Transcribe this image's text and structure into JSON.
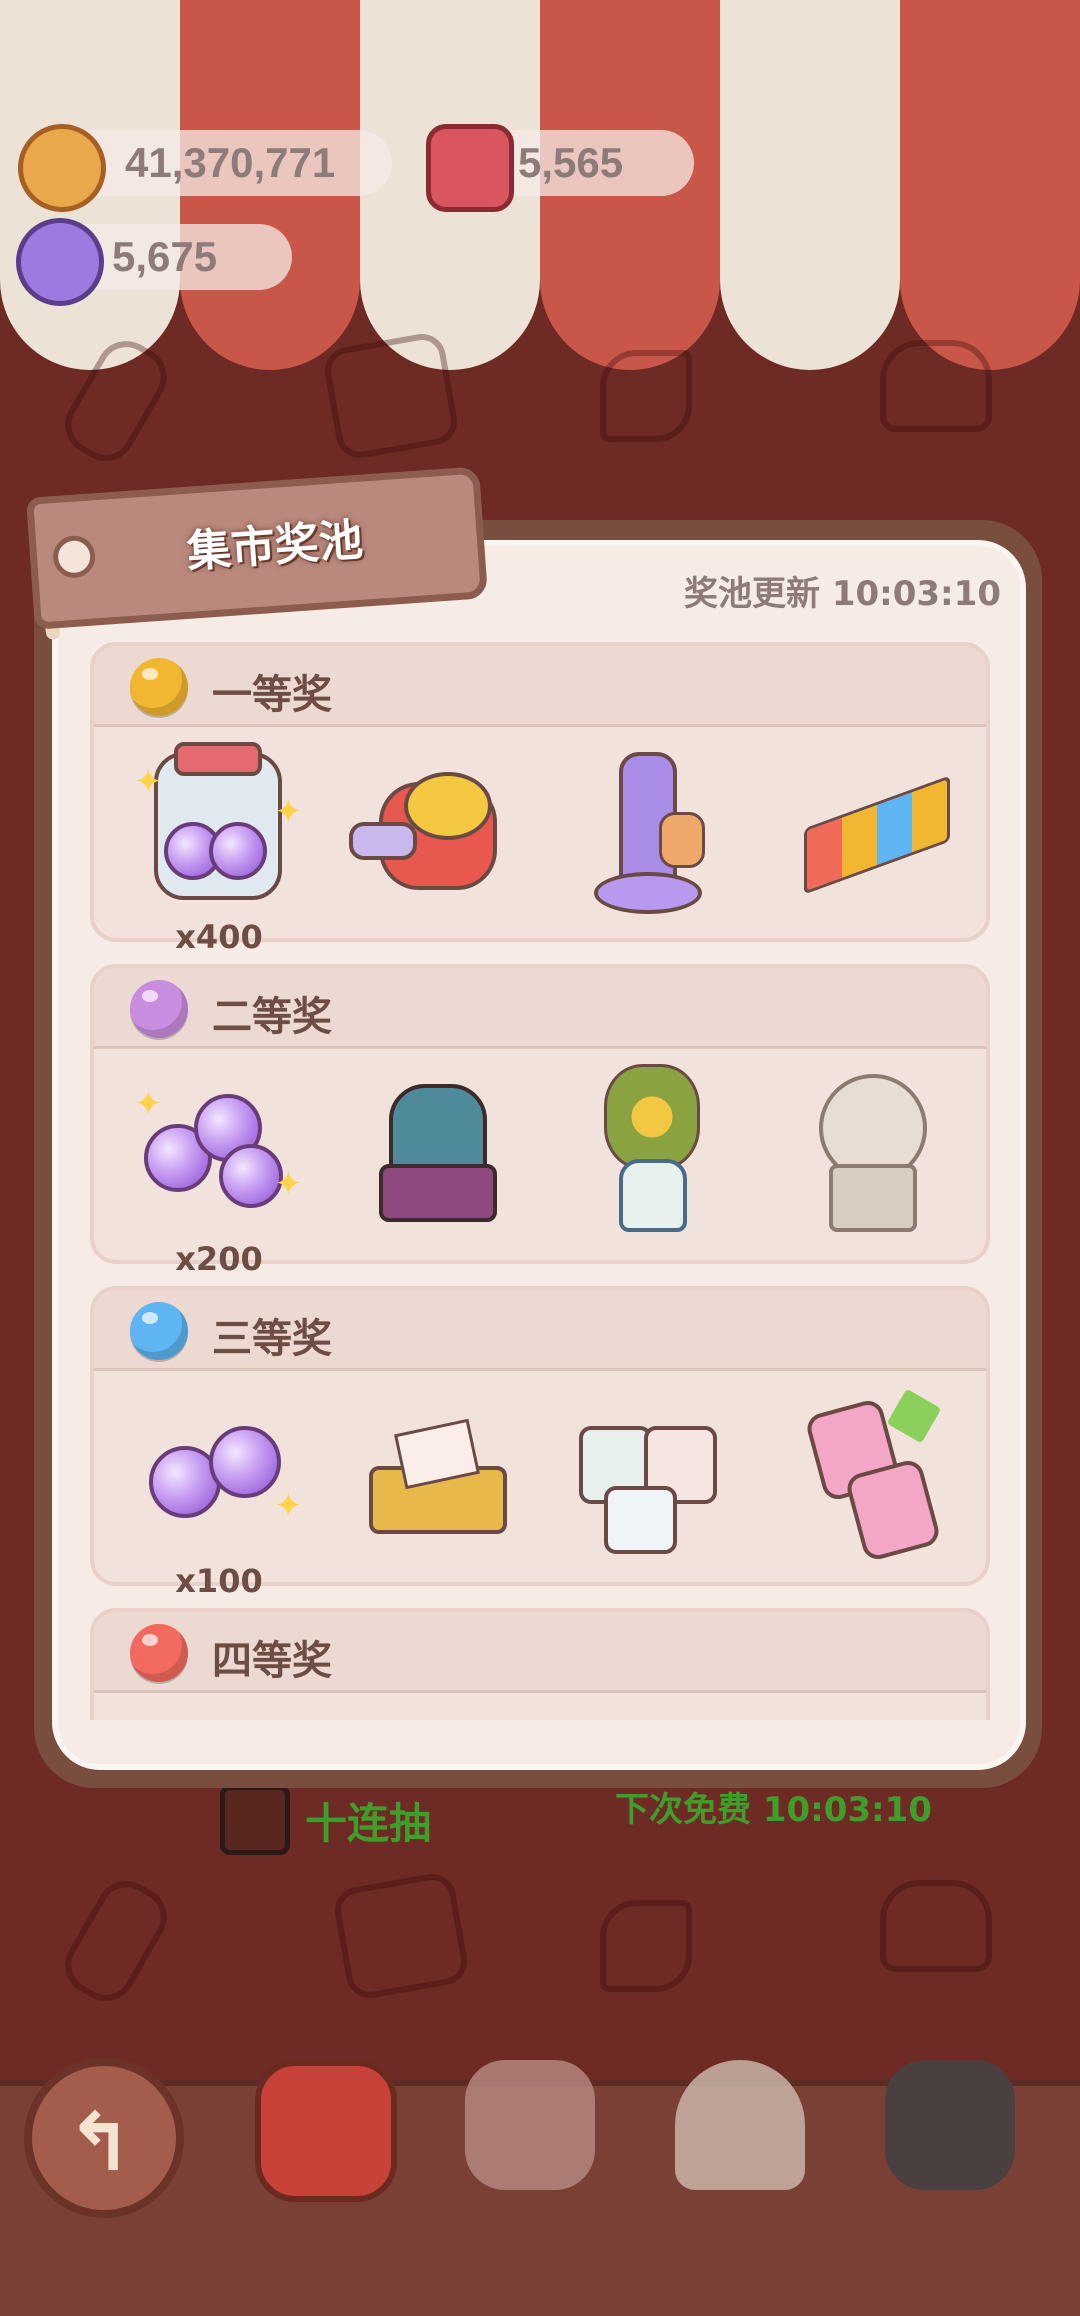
{
  "currencies": [
    {
      "name": "cookie-coin",
      "value": "41,370,771",
      "color": "#e9a84a"
    },
    {
      "name": "red-candle",
      "value": "5,565",
      "color": "#d9555f"
    },
    {
      "name": "purple-candy",
      "value": "5,675",
      "color": "#9c7be0"
    }
  ],
  "background": {
    "ten_draw_label": "十连抽",
    "next_free_label": "下次免费 10:03:10"
  },
  "modal": {
    "title": "集市奖池",
    "update_text": "奖池更新 10:03:10",
    "tiers": [
      {
        "name": "一等奖",
        "ball_color": "#f2b731",
        "items": [
          {
            "icon": "candy-jar-icon",
            "qty": "x400"
          },
          {
            "icon": "airplane-teapot-icon",
            "qty": ""
          },
          {
            "icon": "cat-tree-icon",
            "qty": ""
          },
          {
            "icon": "hopscotch-mat-icon",
            "qty": ""
          }
        ]
      },
      {
        "name": "二等奖",
        "ball_color": "#c98de0",
        "items": [
          {
            "icon": "candy-pile-icon",
            "qty": "x200"
          },
          {
            "icon": "backpack-icon",
            "qty": ""
          },
          {
            "icon": "flower-vase-icon",
            "qty": ""
          },
          {
            "icon": "poodle-statue-icon",
            "qty": ""
          }
        ]
      },
      {
        "name": "三等奖",
        "ball_color": "#5fb4f2",
        "items": [
          {
            "icon": "candy-pair-icon",
            "qty": "x100"
          },
          {
            "icon": "letter-basket-icon",
            "qty": ""
          },
          {
            "icon": "paint-buckets-icon",
            "qty": ""
          },
          {
            "icon": "flip-phone-icon",
            "qty": ""
          }
        ]
      },
      {
        "name": "四等奖",
        "ball_color": "#f26a5f",
        "items": []
      }
    ]
  },
  "nav": {
    "items": [
      "back-icon",
      "market-stall-icon",
      "twin-bunny-icon",
      "mushroom-house-icon",
      "dark-beast-icon"
    ]
  }
}
